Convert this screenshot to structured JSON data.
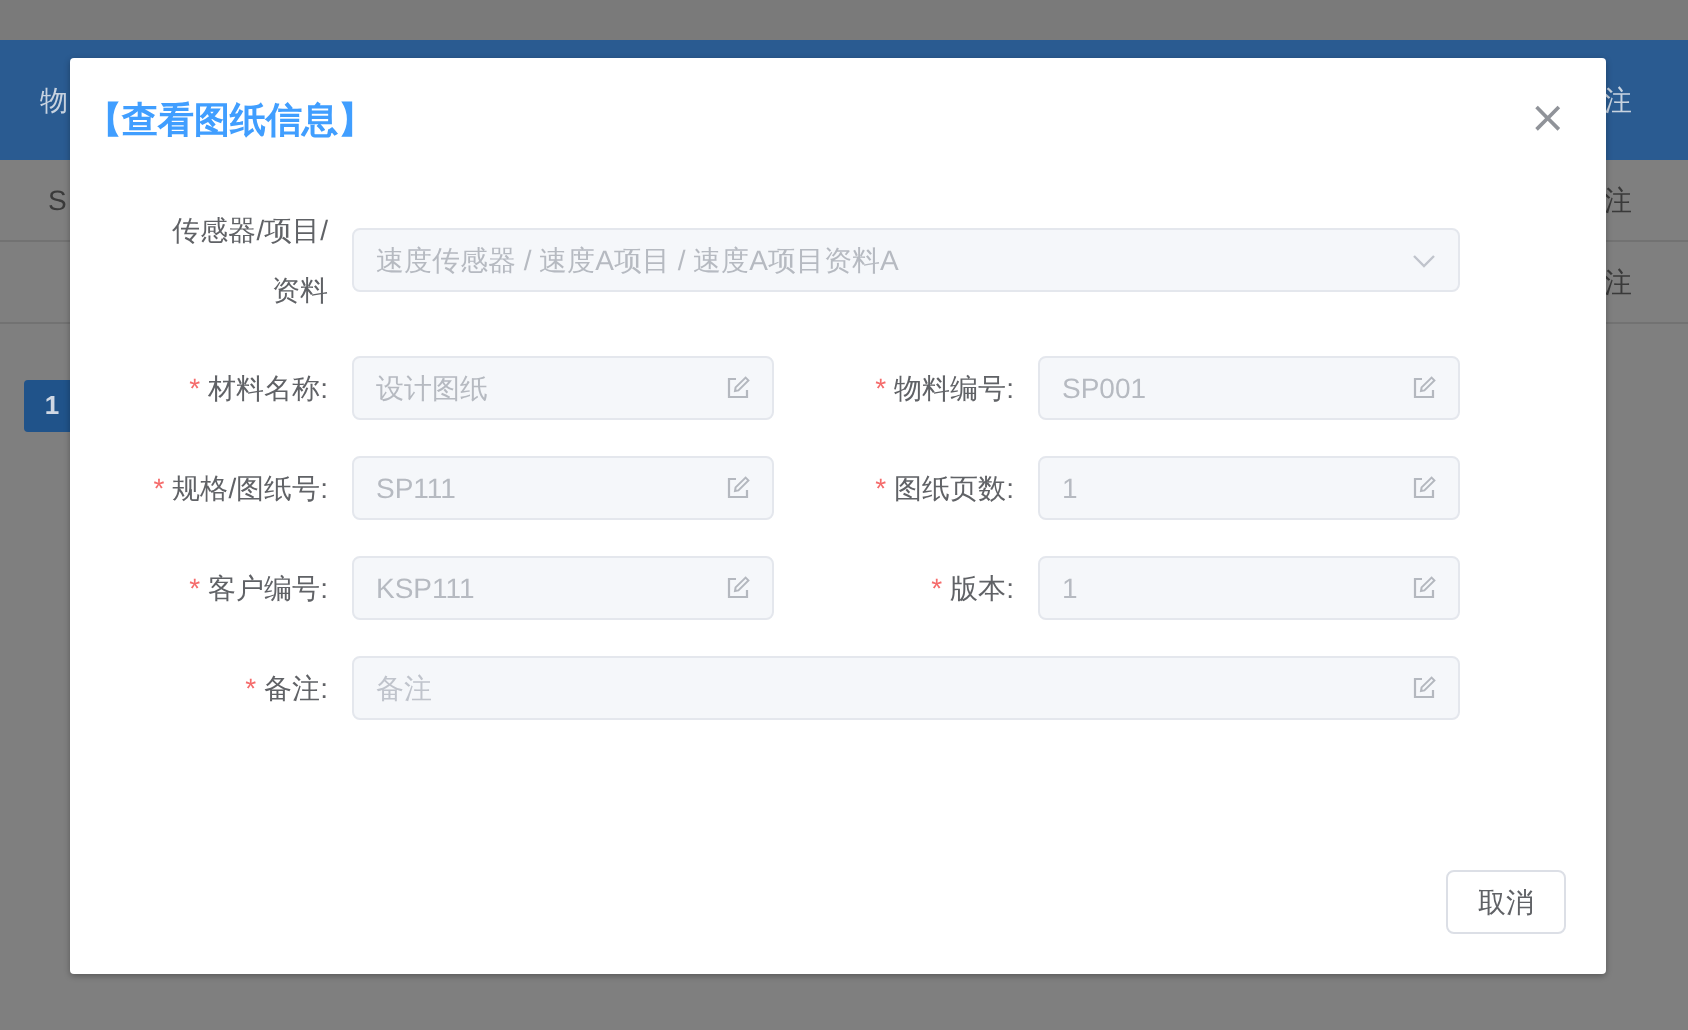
{
  "background_table": {
    "header": {
      "column_1": "物",
      "column_last": "注"
    },
    "rows": [
      {
        "column_1": "S",
        "column_last": "注"
      },
      {
        "column_last": "注"
      }
    ]
  },
  "pagination": {
    "pages": [
      {
        "label": "1",
        "selected": true
      }
    ]
  },
  "dialog": {
    "title": "【查看图纸信息】",
    "close": "×",
    "fields": [
      {
        "kind": "cascader",
        "label": "传感器/项目/资料",
        "value": "速度传感器 / 速度A项目 / 速度A项目资料A",
        "disabled": true,
        "wide": true
      },
      {
        "kind": "input",
        "required_mark": "*",
        "label": "材料名称:",
        "value": "设计图纸",
        "disabled": true,
        "wide": false
      },
      {
        "kind": "input",
        "required_mark": "*",
        "label": "物料编号:",
        "value": "SP001",
        "disabled": true,
        "wide": false
      },
      {
        "kind": "input",
        "required_mark": "*",
        "label": "规格/图纸号:",
        "value": "SP111",
        "disabled": true,
        "wide": false
      },
      {
        "kind": "input",
        "required_mark": "*",
        "label": "图纸页数:",
        "value": "1",
        "disabled": true,
        "wide": false
      },
      {
        "kind": "input",
        "required_mark": "*",
        "label": "客户编号:",
        "value": "KSP111",
        "disabled": true,
        "wide": false
      },
      {
        "kind": "input",
        "required_mark": "*",
        "label": "版本:",
        "value": "1",
        "disabled": true,
        "wide": false
      },
      {
        "kind": "input",
        "required_mark": "*",
        "label": "备注:",
        "placeholder": "备注",
        "disabled": true,
        "wide": true
      }
    ],
    "buttons": [
      "取消"
    ]
  }
}
